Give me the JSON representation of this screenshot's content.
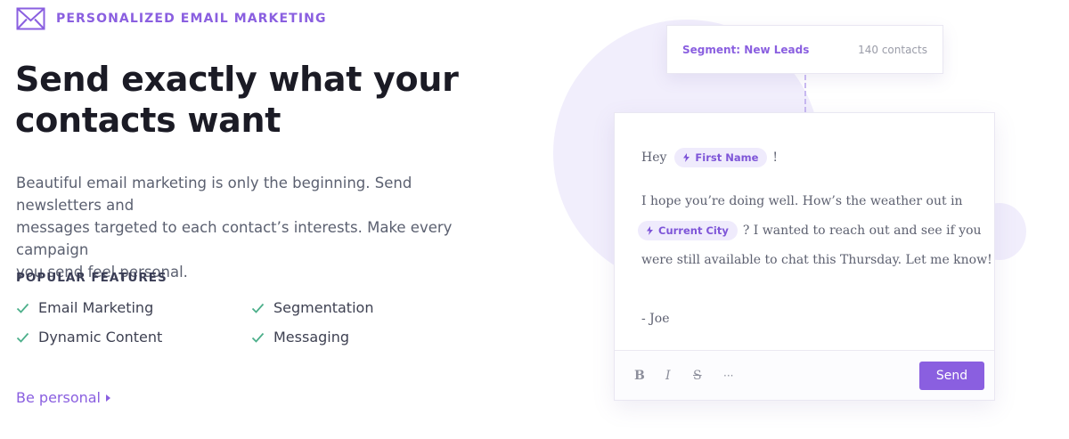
{
  "eyebrow": {
    "icon": "envelope-icon",
    "label": "PERSONALIZED EMAIL MARKETING"
  },
  "headline": {
    "line1": "Send exactly what your",
    "line2": "contacts want"
  },
  "lead": {
    "line1": "Beautiful email marketing is only the beginning. Send newsletters and",
    "line2": "messages targeted to each contact’s interests. Make every campaign",
    "line3": "you send feel personal."
  },
  "features": {
    "title": "POPULAR FEATURES",
    "items": [
      {
        "label": "Email Marketing",
        "icon": "check-icon"
      },
      {
        "label": "Segmentation",
        "icon": "check-icon"
      },
      {
        "label": "Dynamic Content",
        "icon": "check-icon"
      },
      {
        "label": "Messaging",
        "icon": "check-icon"
      }
    ]
  },
  "cta": {
    "label": "Be personal",
    "icon": "caret-right-icon"
  },
  "segment": {
    "label": "Segment: New Leads",
    "count": "140 contacts"
  },
  "email": {
    "greeting": "Hey",
    "first_name_tag": "First Name",
    "exclaim": "!",
    "body_line1": "I hope you’re doing well. How’s the weather out in",
    "city_tag": "Current City",
    "body_line2_rest": "? I wanted to reach out and see if you",
    "body_line3": "were still available to chat this Thursday. Let me know!",
    "signoff": "- Joe"
  },
  "toolbar": {
    "bold": "B",
    "italic": "I",
    "strike": "S",
    "more": "···",
    "send_label": "Send"
  },
  "colors": {
    "accent": "#8a5fe0",
    "check": "#4caf8a",
    "tag_bg": "#efebfc",
    "blob": "#f1eefc"
  }
}
